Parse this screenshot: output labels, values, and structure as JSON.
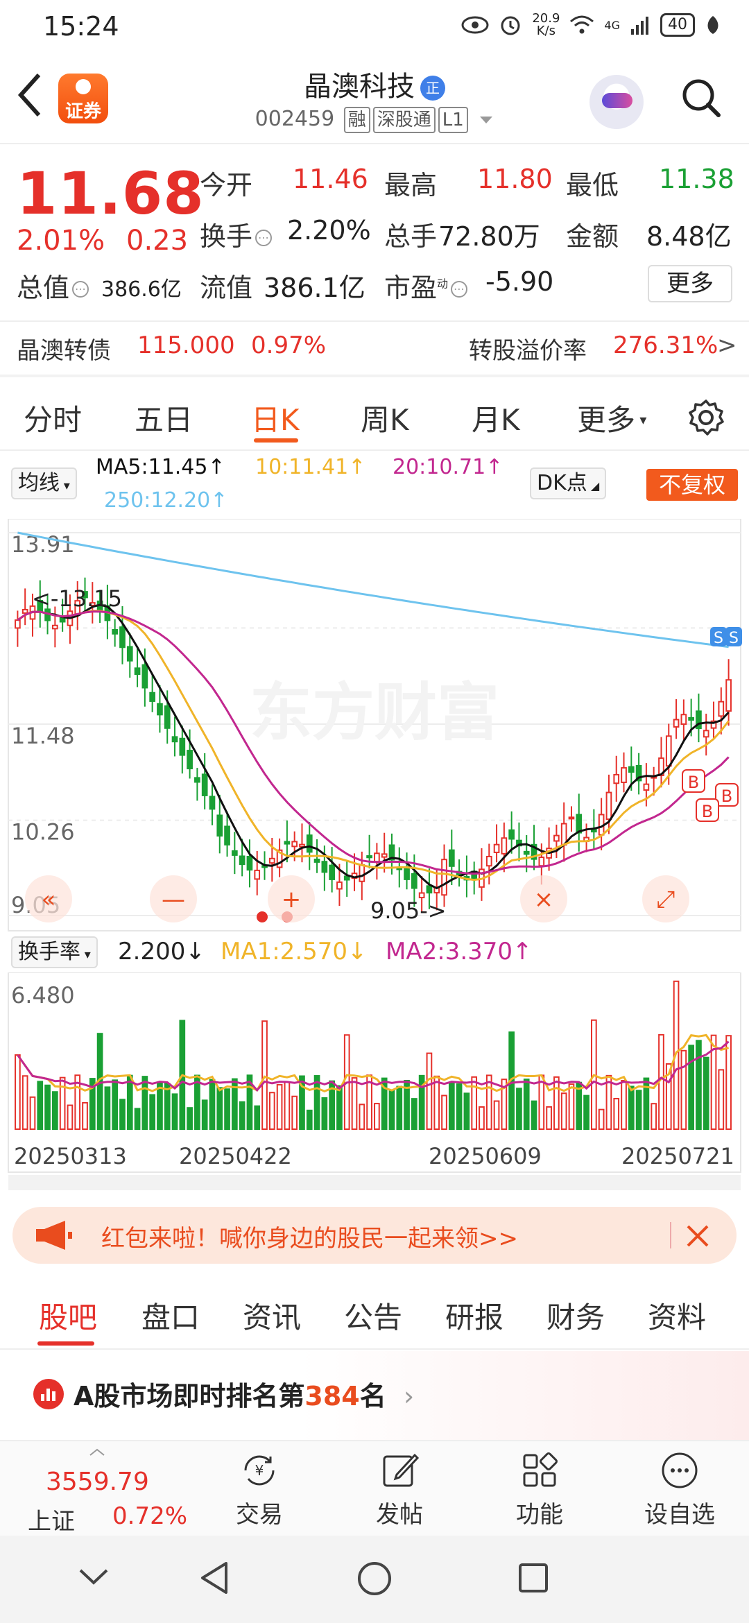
{
  "status": {
    "time": "15:24",
    "net_speed": "20.9\nK/s",
    "signal": "4G",
    "battery": "40"
  },
  "header": {
    "logo_text": "证券",
    "stock_name": "晶澳科技",
    "badge": "正",
    "code": "002459",
    "tags": [
      "融",
      "深股通",
      "L1"
    ]
  },
  "quote": {
    "price": "11.68",
    "change_pct": "2.01%",
    "change_amt": "0.23",
    "rows": [
      [
        {
          "label": "今开",
          "value": "11.46",
          "color": "red"
        },
        {
          "label": "最高",
          "value": "11.80",
          "color": "red"
        },
        {
          "label": "最低",
          "value": "11.38",
          "color": "green"
        }
      ],
      [
        {
          "label": "换手",
          "value": "2.20%",
          "color": "dark"
        },
        {
          "label": "总手",
          "value": "72.80万",
          "color": "dark"
        },
        {
          "label": "金额",
          "value": "8.48亿",
          "color": "dark"
        }
      ],
      [
        {
          "label": "总值",
          "value": "386.6亿",
          "color": "dark"
        },
        {
          "label": "流值",
          "value": "386.1亿",
          "color": "dark"
        },
        {
          "label": "市盈",
          "value": "-5.90",
          "color": "dark"
        }
      ]
    ],
    "pe_sup": "动",
    "more": "更多"
  },
  "bond": {
    "name": "晶澳转债",
    "price": "115.000",
    "pct": "0.97%",
    "premium_label": "转股溢价率",
    "premium": "276.31%",
    "arrow": ">"
  },
  "ktabs": [
    "分时",
    "五日",
    "日K",
    "周K",
    "月K",
    "更多"
  ],
  "ktab_active": "日K",
  "legend": {
    "ma_btn": "均线",
    "ma5": "MA5:11.45↑",
    "ma10": "10:11.41↑",
    "ma20": "20:10.71↑",
    "ma250": "250:12.20↑",
    "dk": "DK点",
    "fq": "不复权"
  },
  "vol_legend": {
    "btn": "换手率",
    "val": "2.200↓",
    "ma1": "MA1:2.570↓",
    "ma2": "MA2:3.370↑",
    "max": "6.480"
  },
  "colors": {
    "up": "#e5302a",
    "down": "#1aa034",
    "ma5": "#111111",
    "ma10": "#f0b429",
    "ma20": "#c2278f",
    "ma250": "#6ec3ee",
    "accent": "#f25a1d"
  },
  "chart_data": {
    "type": "candlestick",
    "y_ticks": [
      "13.91",
      "11.48",
      "10.26",
      "9.05"
    ],
    "ylim": [
      9.05,
      13.91
    ],
    "annotations": {
      "high": "<-13.15",
      "low": "9.05->"
    },
    "watermark": "东方财富",
    "x_labels": [
      "20250313",
      "20250422",
      "20250609",
      "20250721"
    ],
    "ma_latest": {
      "MA5": 11.45,
      "MA10": 11.41,
      "MA20": 10.71,
      "MA250": 12.2
    },
    "last_close": 11.68,
    "volume_max": 6.48
  },
  "banner": {
    "text": "红包来啦！喊你身边的股民一起来领>>"
  },
  "btabs": [
    "股吧",
    "盘口",
    "资讯",
    "公告",
    "研报",
    "财务",
    "资料"
  ],
  "rank": {
    "prefix": "A股市场即时排名第",
    "num": "384",
    "suffix": "名",
    "arrow": "›"
  },
  "footer": {
    "index_value": "3559.79",
    "index_name": "上证",
    "index_pct": "0.72%",
    "items": [
      "交易",
      "发帖",
      "功能",
      "设自选"
    ]
  }
}
